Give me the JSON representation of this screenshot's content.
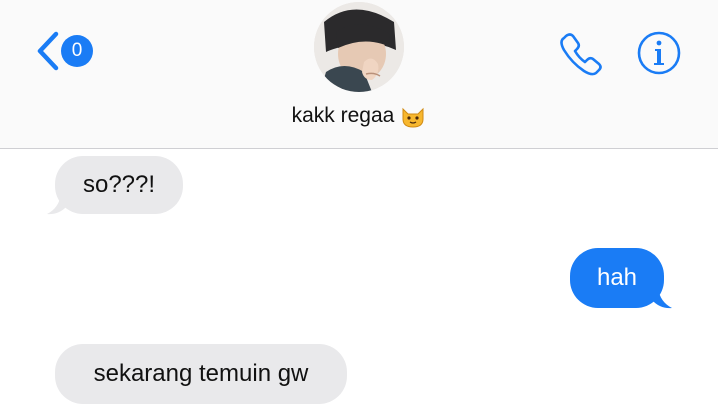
{
  "header": {
    "back_badge_count": "0",
    "contact_name": "kakk regaa",
    "accent_color": "#1a7cf5"
  },
  "icons": {
    "back": "chevron-left-icon",
    "call": "phone-icon",
    "info": "info-icon",
    "emoji": "cat-face-emoji-icon"
  },
  "messages": [
    {
      "direction": "incoming",
      "text": "so???!"
    },
    {
      "direction": "outgoing",
      "text": "hah"
    },
    {
      "direction": "incoming",
      "text": "sekarang temuin gw"
    }
  ]
}
